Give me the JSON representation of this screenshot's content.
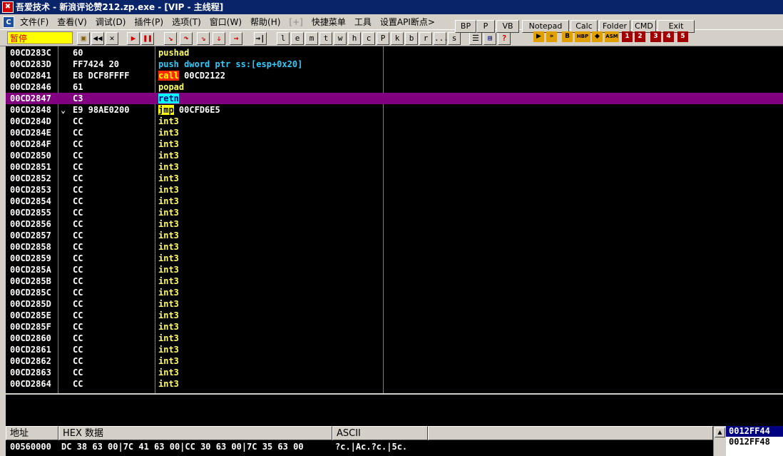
{
  "title": "吾爱技术 - 新浪评论赞212.zp.exe - [VIP - 主线程]",
  "menu": [
    "文件(F)",
    "查看(V)",
    "调试(D)",
    "插件(P)",
    "选项(T)",
    "窗口(W)",
    "帮助(H)",
    "[+]",
    "快捷菜单",
    "工具",
    "设置API断点>"
  ],
  "status": "暂停",
  "toolbar_letters": [
    "l",
    "e",
    "m",
    "t",
    "w",
    "h",
    "c",
    "P",
    "k",
    "b",
    "r",
    "...",
    "s"
  ],
  "ext_buttons": [
    "BP",
    "P",
    "VB",
    "Notepad",
    "Calc",
    "Folder",
    "CMD",
    "Exit"
  ],
  "icon_buttons": [
    "▶",
    "»",
    "HBP",
    "◆",
    "ASM",
    "1",
    "2",
    "3",
    "4",
    "5"
  ],
  "disasm": [
    {
      "addr": "00CD283C",
      "bytes": "60",
      "mnem": "pushad",
      "ops": "",
      "style": "yellow"
    },
    {
      "addr": "00CD283D",
      "bytes": "FF7424 20",
      "mnem": "push",
      "ops": "dword ptr ss:[esp+0x20]",
      "style": "push"
    },
    {
      "addr": "00CD2841",
      "bytes": "E8 DCF8FFFF",
      "mnem": "call",
      "ops": "00CD2122",
      "style": "call"
    },
    {
      "addr": "00CD2846",
      "bytes": "61",
      "mnem": "popad",
      "ops": "",
      "style": "yellow"
    },
    {
      "addr": "00CD2847",
      "bytes": "C3",
      "mnem": "retn",
      "ops": "",
      "style": "retn",
      "selected": true
    },
    {
      "addr": "00CD2848",
      "bytes": "E9 98AE0200",
      "mnem": "jmp",
      "ops": "00CFD6E5",
      "style": "jmp",
      "mark": "⌄"
    },
    {
      "addr": "00CD284D",
      "bytes": "CC",
      "mnem": "int3",
      "ops": "",
      "style": "yellow"
    },
    {
      "addr": "00CD284E",
      "bytes": "CC",
      "mnem": "int3",
      "ops": "",
      "style": "yellow"
    },
    {
      "addr": "00CD284F",
      "bytes": "CC",
      "mnem": "int3",
      "ops": "",
      "style": "yellow"
    },
    {
      "addr": "00CD2850",
      "bytes": "CC",
      "mnem": "int3",
      "ops": "",
      "style": "yellow"
    },
    {
      "addr": "00CD2851",
      "bytes": "CC",
      "mnem": "int3",
      "ops": "",
      "style": "yellow"
    },
    {
      "addr": "00CD2852",
      "bytes": "CC",
      "mnem": "int3",
      "ops": "",
      "style": "yellow"
    },
    {
      "addr": "00CD2853",
      "bytes": "CC",
      "mnem": "int3",
      "ops": "",
      "style": "yellow"
    },
    {
      "addr": "00CD2854",
      "bytes": "CC",
      "mnem": "int3",
      "ops": "",
      "style": "yellow"
    },
    {
      "addr": "00CD2855",
      "bytes": "CC",
      "mnem": "int3",
      "ops": "",
      "style": "yellow"
    },
    {
      "addr": "00CD2856",
      "bytes": "CC",
      "mnem": "int3",
      "ops": "",
      "style": "yellow"
    },
    {
      "addr": "00CD2857",
      "bytes": "CC",
      "mnem": "int3",
      "ops": "",
      "style": "yellow"
    },
    {
      "addr": "00CD2858",
      "bytes": "CC",
      "mnem": "int3",
      "ops": "",
      "style": "yellow"
    },
    {
      "addr": "00CD2859",
      "bytes": "CC",
      "mnem": "int3",
      "ops": "",
      "style": "yellow"
    },
    {
      "addr": "00CD285A",
      "bytes": "CC",
      "mnem": "int3",
      "ops": "",
      "style": "yellow"
    },
    {
      "addr": "00CD285B",
      "bytes": "CC",
      "mnem": "int3",
      "ops": "",
      "style": "yellow"
    },
    {
      "addr": "00CD285C",
      "bytes": "CC",
      "mnem": "int3",
      "ops": "",
      "style": "yellow"
    },
    {
      "addr": "00CD285D",
      "bytes": "CC",
      "mnem": "int3",
      "ops": "",
      "style": "yellow"
    },
    {
      "addr": "00CD285E",
      "bytes": "CC",
      "mnem": "int3",
      "ops": "",
      "style": "yellow"
    },
    {
      "addr": "00CD285F",
      "bytes": "CC",
      "mnem": "int3",
      "ops": "",
      "style": "yellow"
    },
    {
      "addr": "00CD2860",
      "bytes": "CC",
      "mnem": "int3",
      "ops": "",
      "style": "yellow"
    },
    {
      "addr": "00CD2861",
      "bytes": "CC",
      "mnem": "int3",
      "ops": "",
      "style": "yellow"
    },
    {
      "addr": "00CD2862",
      "bytes": "CC",
      "mnem": "int3",
      "ops": "",
      "style": "yellow"
    },
    {
      "addr": "00CD2863",
      "bytes": "CC",
      "mnem": "int3",
      "ops": "",
      "style": "yellow"
    },
    {
      "addr": "00CD2864",
      "bytes": "CC",
      "mnem": "int3",
      "ops": "",
      "style": "yellow"
    }
  ],
  "dump_headers": [
    "地址",
    "HEX 数据",
    "ASCII"
  ],
  "dump_rows": [
    {
      "addr": "00560000",
      "hex": "DC 38 63 00|7C 41 63 00|CC 30 63 00|7C 35 63 00",
      "ascii": "?c.|Ac.?c.|5c."
    }
  ],
  "stack": [
    {
      "addr": "0012FF44",
      "selected": true
    },
    {
      "addr": "0012FF48",
      "selected": false
    }
  ]
}
